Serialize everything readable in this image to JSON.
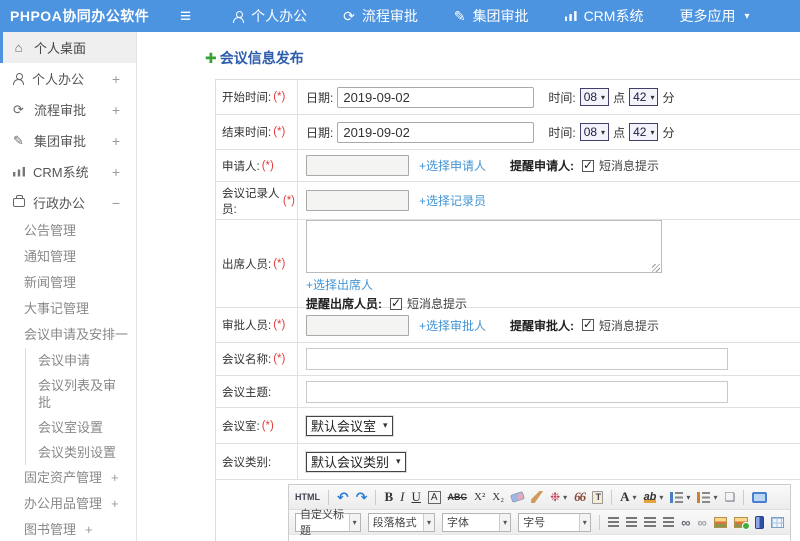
{
  "colors": {
    "topbar": "#4c93e0",
    "link": "#4294d5",
    "title": "#2a5caa",
    "required": "#e43b3b"
  },
  "topbar": {
    "logo": "PHPOA协同办公软件",
    "nav": [
      {
        "label": "个人办公",
        "icon": "person-icon"
      },
      {
        "label": "流程审批",
        "icon": "flow-icon"
      },
      {
        "label": "集团审批",
        "icon": "edit-icon"
      },
      {
        "label": "CRM系统",
        "icon": "chart-icon"
      },
      {
        "label": "更多应用",
        "icon": "caret-down-icon"
      }
    ]
  },
  "sidebar": {
    "items": [
      {
        "label": "个人桌面",
        "active": true
      },
      {
        "label": "个人办公",
        "expand": "+"
      },
      {
        "label": "流程审批",
        "expand": "+"
      },
      {
        "label": "集团审批",
        "expand": "+"
      },
      {
        "label": "CRM系统",
        "expand": "+"
      },
      {
        "label": "行政办公",
        "expand": "−"
      },
      {
        "label": "公告管理"
      },
      {
        "label": "通知管理"
      },
      {
        "label": "新闻管理"
      },
      {
        "label": "大事记管理"
      },
      {
        "label": "会议申请及安排",
        "expand": "一"
      },
      {
        "label": "会议申请"
      },
      {
        "label": "会议列表及审批"
      },
      {
        "label": "会议室设置"
      },
      {
        "label": "会议类别设置"
      },
      {
        "label": "固定资产管理",
        "expand": "+"
      },
      {
        "label": "办公用品管理",
        "expand": "+"
      },
      {
        "label": "图书管理",
        "expand": "+"
      }
    ]
  },
  "main": {
    "title": "会议信息发布"
  },
  "form": {
    "required_mark": "(*)",
    "start": {
      "label": "开始时间:",
      "date_label": "日期:",
      "date_value": "2019-09-02",
      "time_label": "时间:",
      "hour": "08",
      "hour_unit": "点",
      "minute": "42",
      "minute_unit": "分"
    },
    "end": {
      "label": "结束时间:",
      "date_label": "日期:",
      "date_value": "2019-09-02",
      "time_label": "时间:",
      "hour": "08",
      "hour_unit": "点",
      "minute": "42",
      "minute_unit": "分"
    },
    "applicant": {
      "label": "申请人:",
      "link": "+选择申请人",
      "remind": "提醒申请人:",
      "sms": "短消息提示"
    },
    "recorder": {
      "label": "会议记录人员:",
      "link": "+选择记录员"
    },
    "attendees": {
      "label": "出席人员:",
      "link": "+选择出席人",
      "remind": "提醒出席人员:",
      "sms": "短消息提示"
    },
    "approver": {
      "label": "审批人员:",
      "link": "+选择审批人",
      "remind": "提醒审批人:",
      "sms": "短消息提示"
    },
    "name": {
      "label": "会议名称:"
    },
    "topic": {
      "label": "会议主题:"
    },
    "room": {
      "label": "会议室:",
      "value": "默认会议室"
    },
    "category": {
      "label": "会议类别:",
      "value": "默认会议类别"
    }
  },
  "editor": {
    "selects": [
      {
        "label": "自定义标题"
      },
      {
        "label": "段落格式"
      },
      {
        "label": "字体"
      },
      {
        "label": "字号"
      }
    ]
  },
  "icons": {
    "hamburger": "≡",
    "caret": "▾",
    "home": "⌂",
    "flow": "⟳",
    "edit": "✎",
    "plus-green": "✚",
    "html": "HTML",
    "undo": "↶",
    "redo": "↷",
    "bold": "B",
    "italic": "I",
    "underline": "U",
    "boxed-a": "A",
    "strike": "ABC",
    "sup": "X²",
    "sub": "X₂",
    "wand": "❉",
    "quote": "66",
    "font-a": "A",
    "highlight": "ab",
    "newpage": "❏",
    "link-glyph": "∞"
  }
}
